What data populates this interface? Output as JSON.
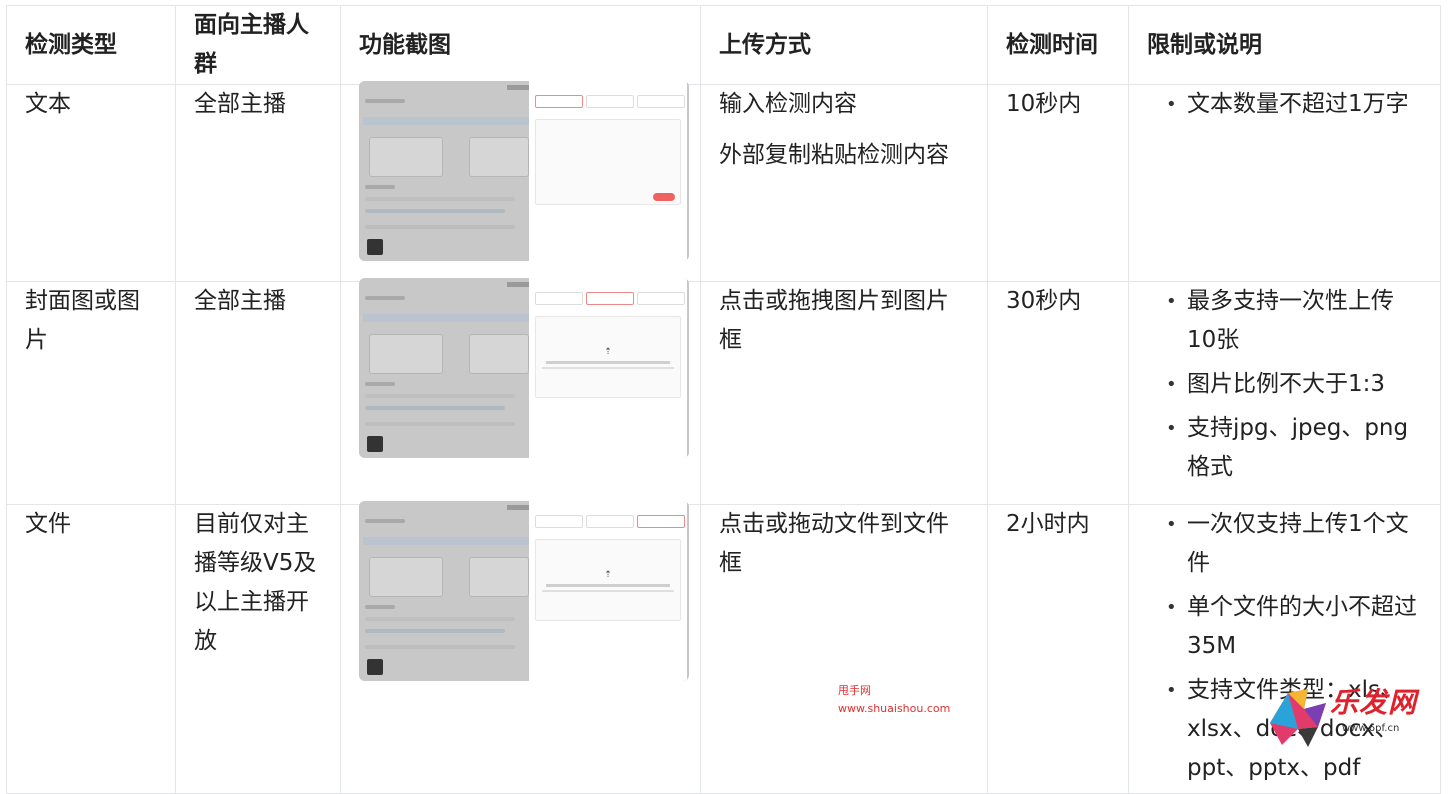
{
  "headers": [
    "检测类型",
    "面向主播人群",
    "功能截图",
    "上传方式",
    "检测时间",
    "限制或说明"
  ],
  "rows": [
    {
      "type": "文本",
      "audience": "全部主播",
      "upload": [
        "输入检测内容",
        "外部复制粘贴检测内容"
      ],
      "time": "10秒内",
      "limits": [
        "文本数量不超过1万字"
      ],
      "screenshot_active_tab": 0
    },
    {
      "type": "封面图或图片",
      "audience": "全部主播",
      "upload": [
        "点击或拖拽图片到图片框"
      ],
      "time": "30秒内",
      "limits": [
        "最多支持一次性上传10张",
        "图片比例不大于1:3",
        "支持jpg、jpeg、png格式"
      ],
      "screenshot_active_tab": 1
    },
    {
      "type": "文件",
      "audience": "目前仅对主播等级V5及以上主播开放",
      "upload": [
        "点击或拖动文件到文件框"
      ],
      "time": "2小时内",
      "limits": [
        "一次仅支持上传1个文件",
        "单个文件的大小不超过35M",
        "支持文件类型：xls、xlsx、doc、docx、ppt、pptx、pdf"
      ],
      "screenshot_active_tab": 2
    }
  ],
  "watermarks": {
    "site_name": "甩手网",
    "site_url": "www.shuaishou.com",
    "logo_text": "乐发网",
    "logo_url": "www.6pf.cn"
  }
}
